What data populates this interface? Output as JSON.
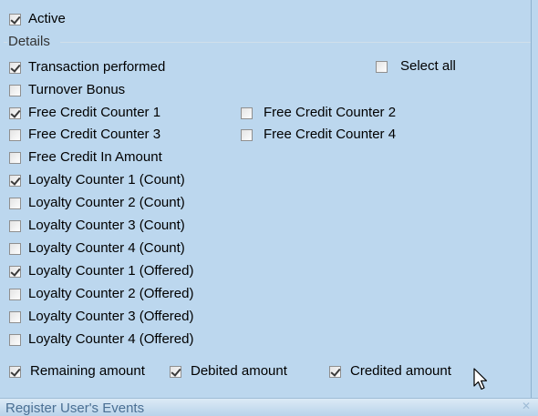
{
  "active": {
    "label": "Active",
    "checked": true
  },
  "details": {
    "title": "Details",
    "select_all": {
      "label": "Select all",
      "checked": false
    },
    "left_items": [
      {
        "label": "Transaction performed",
        "checked": true
      },
      {
        "label": "Turnover Bonus",
        "checked": false
      },
      {
        "label": "Free Credit Counter 1",
        "checked": true
      },
      {
        "label": "Free Credit Counter 3",
        "checked": false
      },
      {
        "label": "Free Credit In Amount",
        "checked": false
      },
      {
        "label": "Loyalty Counter 1 (Count)",
        "checked": true
      },
      {
        "label": "Loyalty Counter 2 (Count)",
        "checked": false
      },
      {
        "label": "Loyalty Counter 3 (Count)",
        "checked": false
      },
      {
        "label": "Loyalty Counter 4 (Count)",
        "checked": false
      },
      {
        "label": "Loyalty Counter 1 (Offered)",
        "checked": true
      },
      {
        "label": "Loyalty Counter 2 (Offered)",
        "checked": false
      },
      {
        "label": "Loyalty Counter 3 (Offered)",
        "checked": false
      },
      {
        "label": "Loyalty Counter 4 (Offered)",
        "checked": false
      }
    ],
    "right_items": [
      {
        "label": "Free Credit Counter 2",
        "checked": false
      },
      {
        "label": "Free Credit Counter 4",
        "checked": false
      }
    ],
    "amounts": [
      {
        "label": "Remaining amount",
        "checked": true
      },
      {
        "label": "Debited amount",
        "checked": true
      },
      {
        "label": "Credited amount",
        "checked": true
      }
    ]
  },
  "footer": {
    "title": "Register User's Events"
  },
  "icons": {
    "cursor": "arrow-cursor-icon",
    "close": "close-icon"
  },
  "colors": {
    "panel": "#bcd7ee",
    "footer_text": "#4a6f93"
  }
}
